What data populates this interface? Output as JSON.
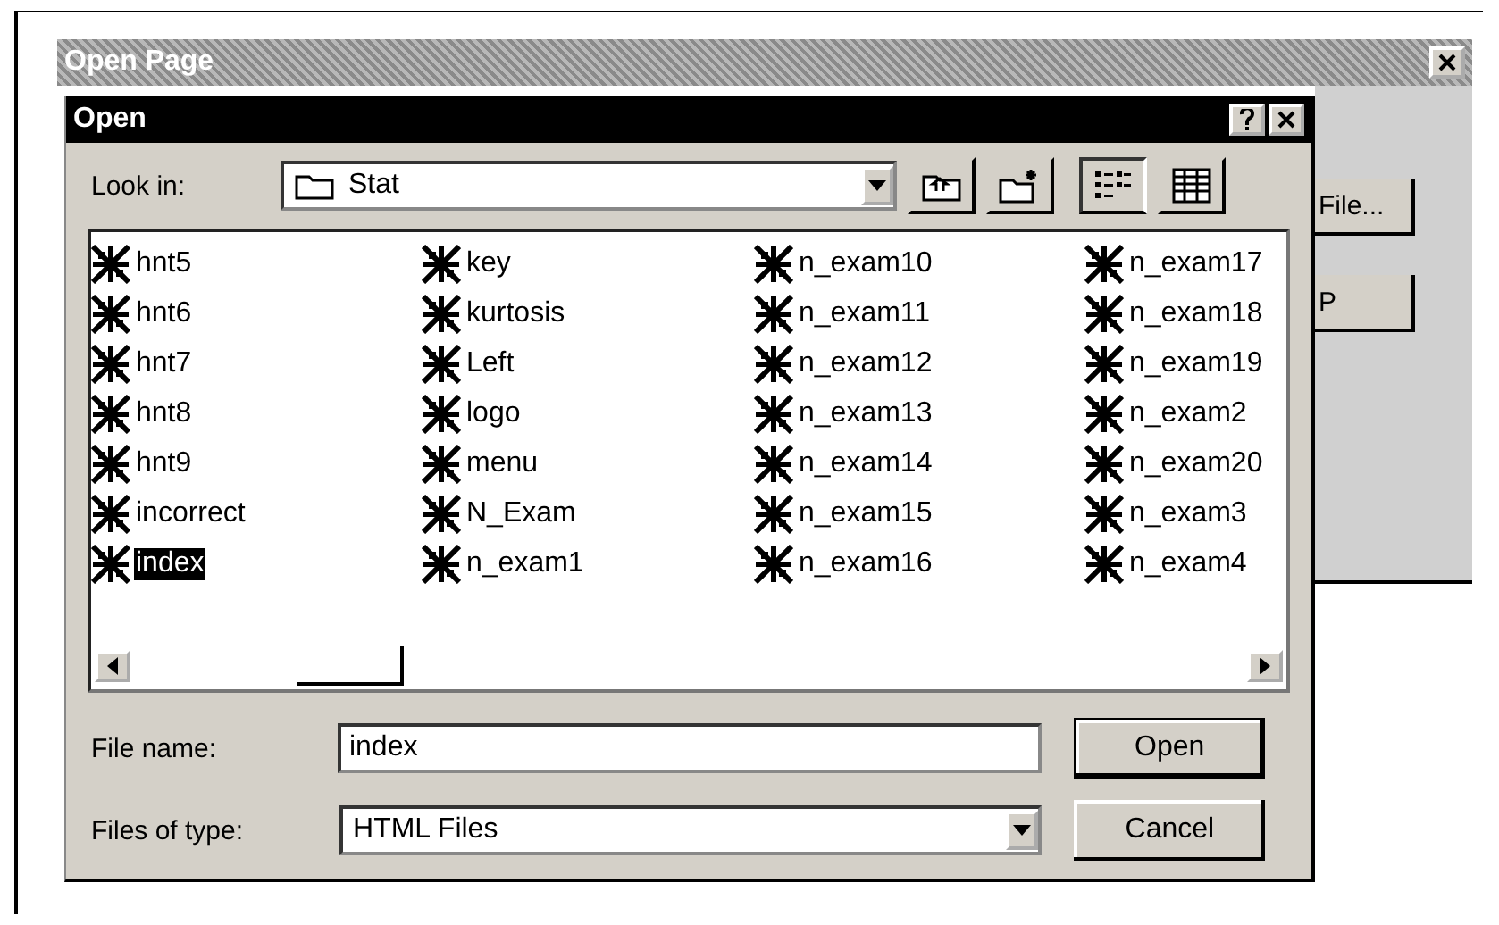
{
  "outer_window": {
    "title": "Open Page",
    "side_buttons": [
      {
        "label": "File..."
      },
      {
        "label": "P"
      }
    ]
  },
  "dialog": {
    "title": "Open",
    "look_in": {
      "label": "Look in:",
      "value": "Stat"
    },
    "toolbar": [
      {
        "kind": "up",
        "selected": false
      },
      {
        "kind": "new-folder",
        "selected": false
      },
      {
        "kind": "list",
        "selected": true
      },
      {
        "kind": "details",
        "selected": false
      }
    ],
    "files": [
      {
        "name": "hnt5",
        "selected": false
      },
      {
        "name": "hnt6",
        "selected": false
      },
      {
        "name": "hnt7",
        "selected": false
      },
      {
        "name": "hnt8",
        "selected": false
      },
      {
        "name": "hnt9",
        "selected": false
      },
      {
        "name": "incorrect",
        "selected": false
      },
      {
        "name": "index",
        "selected": true
      },
      {
        "name": "key",
        "selected": false
      },
      {
        "name": "kurtosis",
        "selected": false
      },
      {
        "name": "Left",
        "selected": false
      },
      {
        "name": "logo",
        "selected": false
      },
      {
        "name": "menu",
        "selected": false
      },
      {
        "name": "N_Exam",
        "selected": false
      },
      {
        "name": "n_exam1",
        "selected": false
      },
      {
        "name": "n_exam10",
        "selected": false
      },
      {
        "name": "n_exam11",
        "selected": false
      },
      {
        "name": "n_exam12",
        "selected": false
      },
      {
        "name": "n_exam13",
        "selected": false
      },
      {
        "name": "n_exam14",
        "selected": false
      },
      {
        "name": "n_exam15",
        "selected": false
      },
      {
        "name": "n_exam16",
        "selected": false
      },
      {
        "name": "n_exam17",
        "selected": false
      },
      {
        "name": "n_exam18",
        "selected": false
      },
      {
        "name": "n_exam19",
        "selected": false
      },
      {
        "name": "n_exam2",
        "selected": false
      },
      {
        "name": "n_exam20",
        "selected": false
      },
      {
        "name": "n_exam3",
        "selected": false
      },
      {
        "name": "n_exam4",
        "selected": false
      }
    ],
    "file_name": {
      "label": "File name:",
      "value": "index"
    },
    "file_type": {
      "label": "Files of type:",
      "value": "HTML Files"
    },
    "buttons": [
      {
        "label": "Open",
        "default": true
      },
      {
        "label": "Cancel",
        "default": false
      }
    ]
  }
}
